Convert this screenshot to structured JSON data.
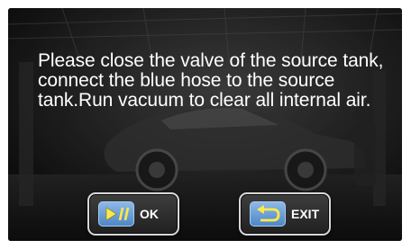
{
  "dialog": {
    "message": "Please close the valve of the source tank, connect the blue hose to the source tank.Run vacuum to clear all internal air.",
    "background_image": "dim-garage-car-photo"
  },
  "buttons": {
    "ok": {
      "label": "OK",
      "icon": "play-pause-icon"
    },
    "exit": {
      "label": "EXIT",
      "icon": "return-arrow-icon"
    }
  },
  "colors": {
    "button_icon_blue": "#5a93cf",
    "icon_glyph": "#ffe84a",
    "text": "#ffffff"
  }
}
